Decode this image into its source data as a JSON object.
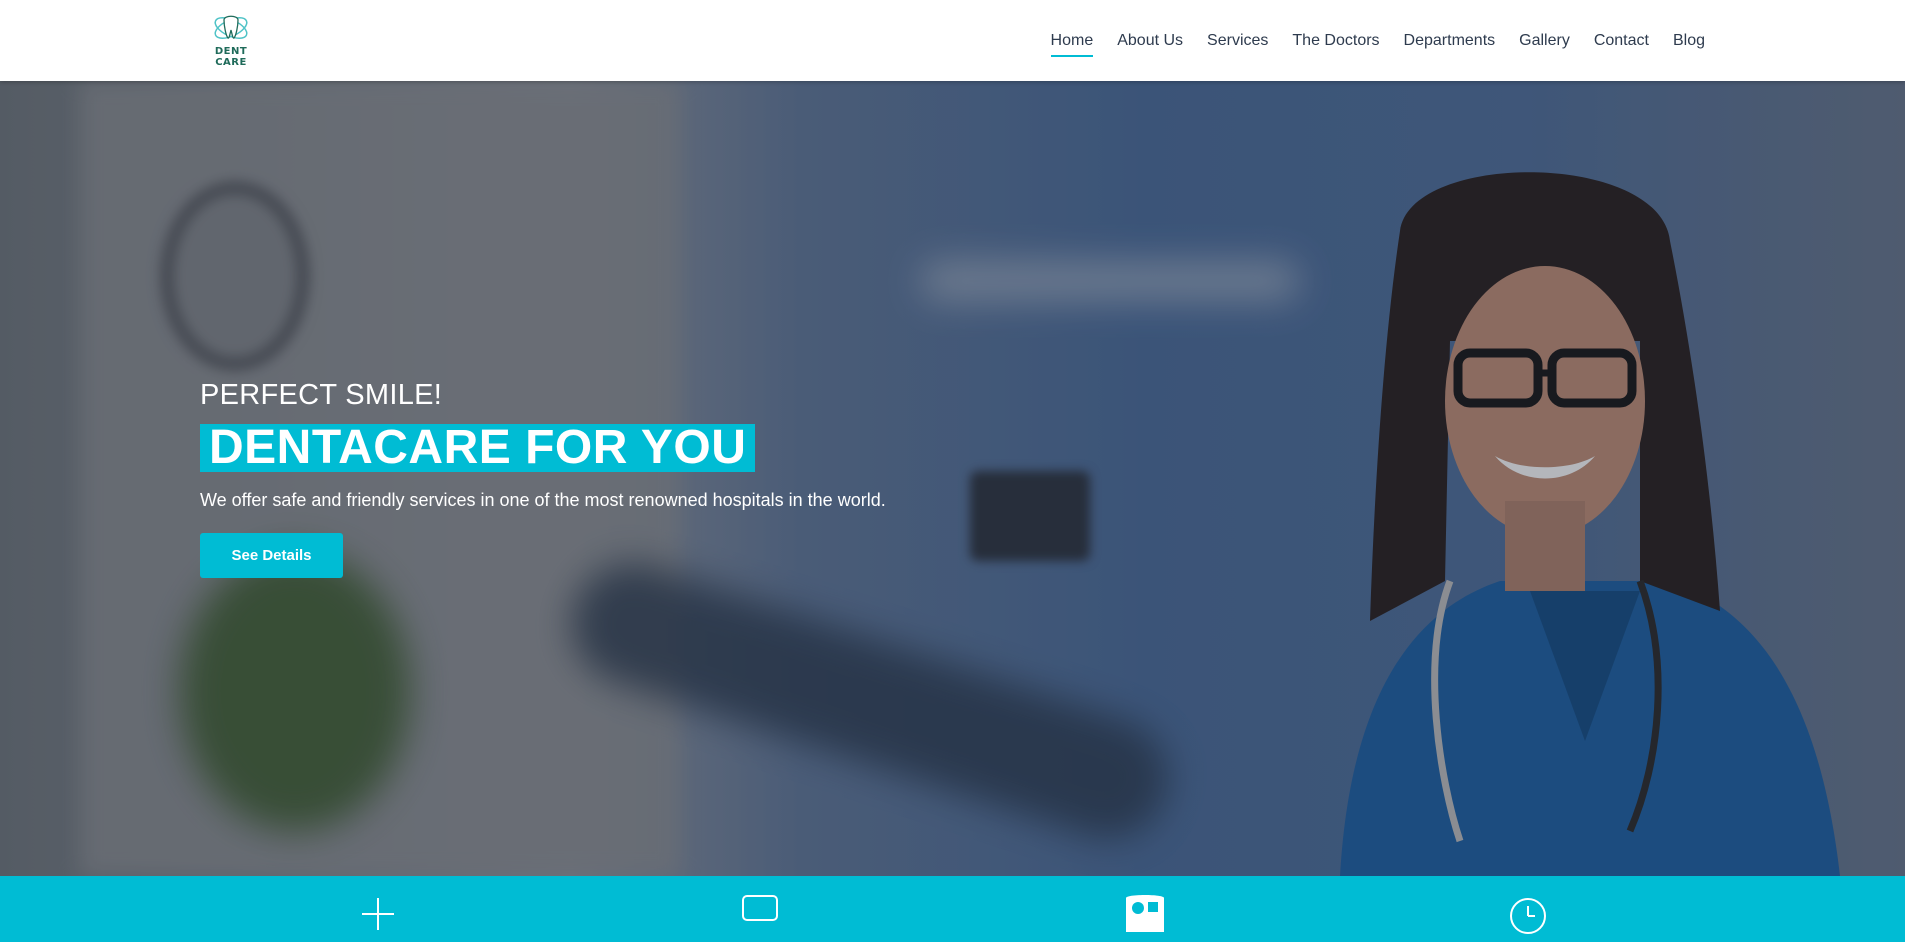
{
  "brand": {
    "logo_text": "DENT CARE",
    "logo_color": "#1f6b5a",
    "logo_accent": "#4fc3c7"
  },
  "nav": {
    "items": [
      {
        "label": "Home",
        "active": true
      },
      {
        "label": "About Us"
      },
      {
        "label": "Services"
      },
      {
        "label": "The Doctors"
      },
      {
        "label": "Departments"
      },
      {
        "label": "Gallery"
      },
      {
        "label": "Contact"
      },
      {
        "label": "Blog"
      }
    ]
  },
  "hero": {
    "subtitle": "PERFECT SMILE!",
    "title": "DENTACARE FOR YOU",
    "description": "We offer safe and friendly services in one of the most renowned hospitals in the world.",
    "button_label": "See Details",
    "background_image": "blurred dental clinic with smiling female doctor in blue scrubs and stethoscope"
  },
  "colors": {
    "accent": "#00bcd4",
    "nav_text": "#2e3b4e",
    "white": "#ffffff"
  },
  "features_band": {
    "icons": [
      "plus-icon",
      "laptop-icon",
      "doctor-kit-icon",
      "clock-icon"
    ]
  }
}
